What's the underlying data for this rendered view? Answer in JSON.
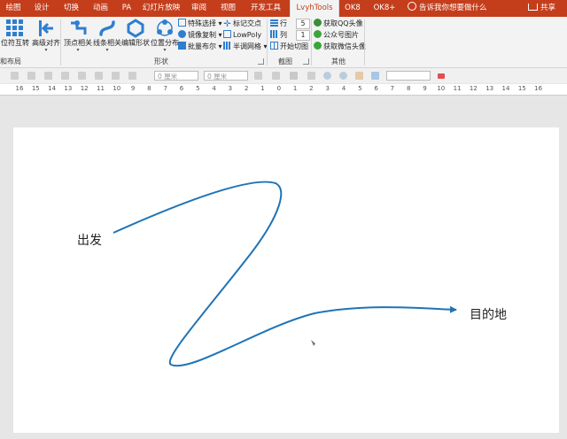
{
  "tabs": [
    {
      "label": "绘图"
    },
    {
      "label": "设计"
    },
    {
      "label": "切换"
    },
    {
      "label": "动画"
    },
    {
      "label": "PA"
    },
    {
      "label": "幻灯片放映"
    },
    {
      "label": "审阅"
    },
    {
      "label": "视图"
    },
    {
      "label": "开发工具"
    },
    {
      "label": "LvyhTools"
    },
    {
      "label": "OK8"
    },
    {
      "label": "OK8+"
    }
  ],
  "tell_me": "告诉我你想要做什么",
  "share": "共享",
  "ribbon": {
    "pos_swap": "位符互转",
    "align": "高级对齐",
    "vertex": "顶点相关",
    "line": "线条相关",
    "edit_shape": "编辑形状",
    "distribute": "位置分布",
    "special_select": "特殊选择",
    "mirror": "镜像复制",
    "batch_bool": "批量布尔",
    "mark_point": "标记交点",
    "lowpoly": "LowPoly",
    "halftone": "半调网格",
    "row": "行",
    "col": "列",
    "row_val": "5",
    "col_val": "1",
    "start_cut": "开始切图",
    "qq": "获取QQ头像",
    "wechat_pic": "公众号图片",
    "wechat_avatar": "获取微信头像",
    "grp_layout": "和布局",
    "grp_shape": "形状",
    "grp_cut": "截图",
    "grp_other": "其他"
  },
  "toolbar": {
    "w_field": "0 厘米",
    "h_field": "0 厘米",
    "x_field": "0 厘米"
  },
  "ruler": [
    "16",
    "15",
    "14",
    "13",
    "12",
    "11",
    "10",
    "9",
    "8",
    "7",
    "6",
    "5",
    "4",
    "3",
    "2",
    "1",
    "0",
    "1",
    "2",
    "3",
    "4",
    "5",
    "6",
    "7",
    "8",
    "9",
    "10",
    "11",
    "12",
    "13",
    "14",
    "15",
    "16"
  ],
  "slide": {
    "start_label": "出发",
    "end_label": "目的地"
  },
  "colors": {
    "tab_bar": "#c43e1c",
    "curve": "#1f74b6"
  }
}
